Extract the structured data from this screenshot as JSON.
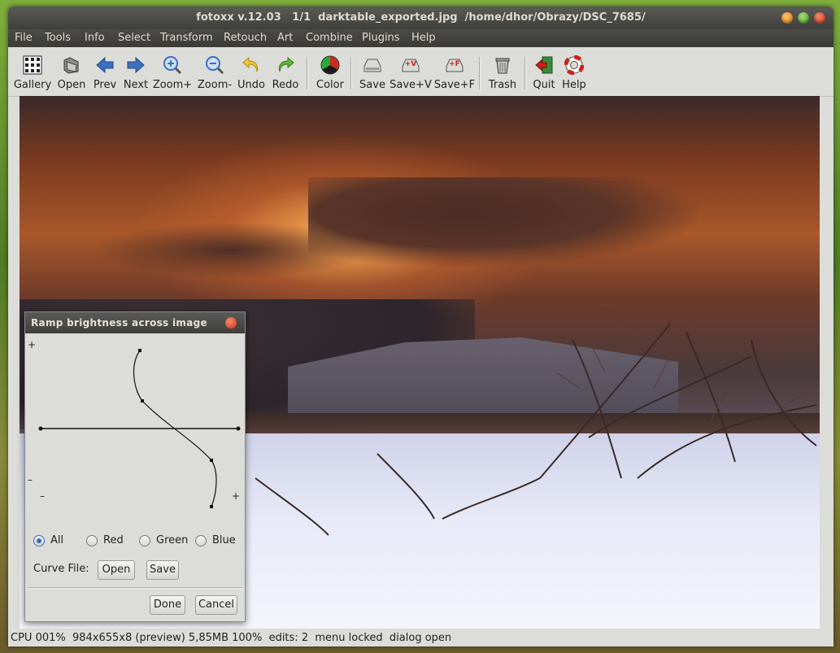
{
  "window": {
    "title": "fotoxx v.12.03   1/1  darktable_exported.jpg  /home/dhor/Obrazy/DSC_7685/"
  },
  "menu": [
    "File",
    "Tools",
    "Info",
    "Select",
    "Transform",
    "Retouch",
    "Art",
    "Combine",
    "Plugins",
    "Help"
  ],
  "toolbar": {
    "gallery": "Gallery",
    "open": "Open",
    "prev": "Prev",
    "next": "Next",
    "zoom_in": "Zoom+",
    "zoom_out": "Zoom-",
    "undo": "Undo",
    "redo": "Redo",
    "color": "Color",
    "save": "Save",
    "save_v": "Save+V",
    "save_f": "Save+F",
    "trash": "Trash",
    "quit": "Quit",
    "help": "Help"
  },
  "dialog": {
    "title": "Ramp brightness across image",
    "axis": {
      "left_top": "+",
      "left_bottom": "–",
      "bottom_left": "–",
      "bottom_right": "+"
    },
    "channels": [
      {
        "label": "All",
        "selected": true
      },
      {
        "label": "Red",
        "selected": false
      },
      {
        "label": "Green",
        "selected": false
      },
      {
        "label": "Blue",
        "selected": false
      }
    ],
    "curve_file_label": "Curve File:",
    "open_label": "Open",
    "save_label": "Save",
    "done_label": "Done",
    "cancel_label": "Cancel"
  },
  "status": {
    "text": "CPU 001%  984x655x8 (preview) 5,85MB 100%  edits: 2  menu locked  dialog open"
  },
  "colors": {
    "titlebar": "#3f3f3b",
    "accent": "#3c6eb4",
    "window_bg": "#dcdcd8"
  }
}
